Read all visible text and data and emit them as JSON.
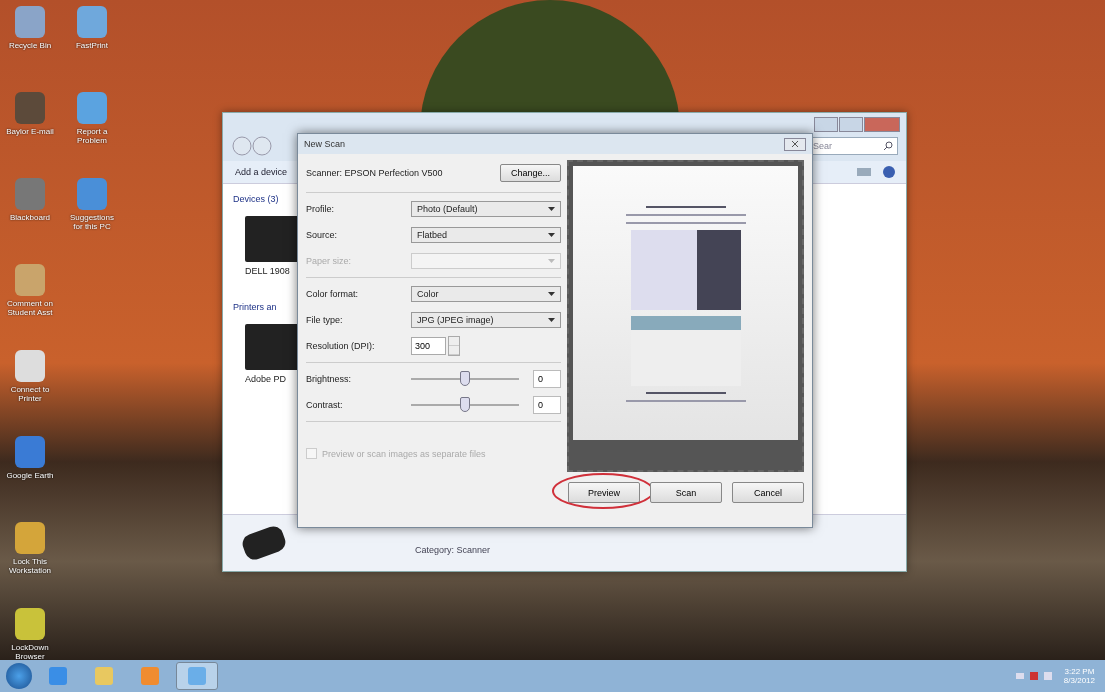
{
  "desktop_icons": [
    {
      "label": "Recycle Bin"
    },
    {
      "label": "FastPrint"
    },
    {
      "label": "Baylor E-mail"
    },
    {
      "label": "Report a Problem"
    },
    {
      "label": "Blackboard"
    },
    {
      "label": "Suggestions for this PC"
    },
    {
      "label": "Comment on Student Asst"
    },
    {
      "label": "Connect to Printer"
    },
    {
      "label": "Google Earth"
    },
    {
      "label": "Lock This Workstation"
    },
    {
      "label": "LockDown Browser"
    }
  ],
  "explorer": {
    "toolbar_button": "Add a device",
    "search_placeholder": "Sear",
    "groups": [
      {
        "title": "Devices (3)",
        "items": [
          "DELL 1908"
        ]
      },
      {
        "title": "Printers an",
        "items": [
          "Adobe PD"
        ]
      }
    ],
    "details": "Category: Scanner"
  },
  "dialog": {
    "title": "New Scan",
    "scanner": "Scanner: EPSON Perfection V500",
    "change_button": "Change...",
    "sections": [
      [
        {
          "kind": "select",
          "label": "Profile:",
          "value": "Photo (Default)",
          "disabled": false
        },
        {
          "kind": "select",
          "label": "Source:",
          "value": "Flatbed",
          "disabled": false
        },
        {
          "kind": "select",
          "label": "Paper size:",
          "disabled": true
        }
      ],
      [
        {
          "kind": "select",
          "label": "Color format:",
          "value": "Color",
          "disabled": false
        },
        {
          "kind": "select",
          "label": "File type:",
          "value": "JPG (JPEG image)",
          "disabled": false
        },
        {
          "kind": "spin",
          "label": "Resolution (DPI):",
          "value": "300",
          "disabled": false
        }
      ],
      [
        {
          "kind": "slider",
          "label": "Brightness:",
          "value": "0",
          "level": 0.5,
          "disabled": false
        },
        {
          "kind": "slider",
          "label": "Contrast:",
          "value": "0",
          "level": 0.5,
          "disabled": false
        }
      ]
    ],
    "checkbox": {
      "label": "Preview or scan images as separate files",
      "checked": false,
      "disabled": true
    },
    "buttons": [
      {
        "label": "Preview",
        "circled": true
      },
      {
        "label": "Scan",
        "circled": false
      },
      {
        "label": "Cancel",
        "circled": false
      }
    ]
  },
  "clock": {
    "time": "3:22 PM",
    "date": "8/3/2012"
  }
}
